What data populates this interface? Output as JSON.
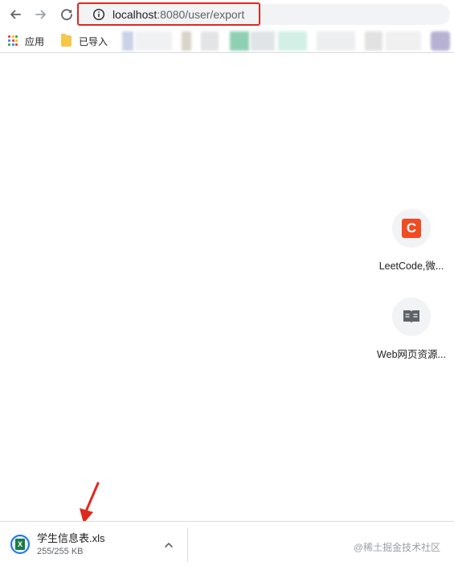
{
  "toolbar": {
    "url_host": "localhost",
    "url_path": ":8080/user/export",
    "back_icon": "arrow-left-icon",
    "forward_icon": "arrow-right-icon",
    "reload_icon": "reload-icon",
    "info_icon": "info-icon"
  },
  "bookmarks": {
    "apps_label": "应用",
    "imported_label": "已导入"
  },
  "shortcuts": [
    {
      "title": "LeetCode,微...",
      "icon": "leetcode-logo-icon"
    },
    {
      "title": "Web网页资源...",
      "icon": "book-icon"
    }
  ],
  "download": {
    "file_name": "学生信息表.xls",
    "file_size": "255/255 KB",
    "file_icon": "excel-file-icon"
  },
  "watermark": "@稀土掘金技术社区",
  "colors": {
    "highlight_red": "#e0281e",
    "leetcode_orange": "#f04b23",
    "excel_green": "#1d7b45",
    "download_blue": "#1a73e8"
  }
}
